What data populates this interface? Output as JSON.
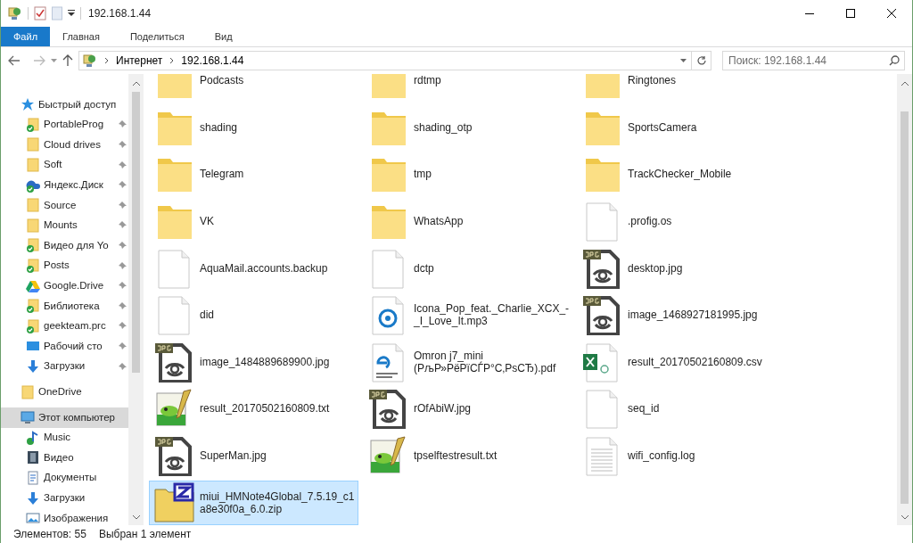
{
  "window": {
    "title": "192.168.1.44"
  },
  "ribbon_tabs": [
    {
      "label": "Файл",
      "kind": "file",
      "selected": false
    },
    {
      "label": "Главная",
      "kind": "tab",
      "selected": false
    },
    {
      "label": "Поделиться",
      "kind": "tab",
      "selected": false
    },
    {
      "label": "Вид",
      "kind": "tab",
      "selected": false
    }
  ],
  "address": {
    "crumbs": [
      "Интернет",
      "192.168.1.44"
    ]
  },
  "search": {
    "placeholder": "Поиск: 192.168.1.44"
  },
  "sidebar": {
    "items": [
      {
        "label": "Быстрый доступ",
        "kind": "star",
        "selected": false,
        "children": [
          {
            "label": "PortableProg",
            "kind": "synced",
            "pinned": true,
            "selected": false
          },
          {
            "label": "Cloud drives",
            "kind": "folder",
            "pinned": true,
            "selected": false
          },
          {
            "label": "Soft",
            "kind": "folder",
            "pinned": true,
            "selected": false
          },
          {
            "label": "Яндекс.Диск",
            "kind": "disk",
            "pinned": true,
            "selected": false
          },
          {
            "label": "Source",
            "kind": "folder",
            "pinned": true,
            "selected": false
          },
          {
            "label": "Mounts",
            "kind": "folder",
            "pinned": true,
            "selected": false
          },
          {
            "label": "Видео для Yo",
            "kind": "synced",
            "pinned": true,
            "selected": false
          },
          {
            "label": "Posts",
            "kind": "synced",
            "pinned": true,
            "selected": false
          },
          {
            "label": "Google.Drive",
            "kind": "gdrive",
            "pinned": true,
            "selected": false
          },
          {
            "label": "Библиотека",
            "kind": "synced",
            "pinned": true,
            "selected": false
          },
          {
            "label": "geekteam.prc",
            "kind": "synced",
            "pinned": true,
            "selected": false
          },
          {
            "label": "Рабочий сто",
            "kind": "desktop",
            "pinned": true,
            "selected": false
          },
          {
            "label": "Загрузки",
            "kind": "download",
            "pinned": true,
            "selected": false
          }
        ]
      },
      {
        "label": "OneDrive",
        "kind": "folder",
        "selected": false
      },
      {
        "label": "Этот компьютер",
        "kind": "pc",
        "selected": true,
        "children": [
          {
            "label": "Music",
            "kind": "music",
            "pinned": false,
            "selected": false
          },
          {
            "label": "Видео",
            "kind": "video",
            "pinned": false,
            "selected": false
          },
          {
            "label": "Документы",
            "kind": "docs",
            "pinned": false,
            "selected": false
          },
          {
            "label": "Загрузки",
            "kind": "download",
            "pinned": false,
            "selected": false
          },
          {
            "label": "Изображения",
            "kind": "images",
            "pinned": false,
            "selected": false
          }
        ]
      }
    ]
  },
  "files": [
    {
      "name": "Podcasts",
      "kind": "folder",
      "selected": false
    },
    {
      "name": "rdtmp",
      "kind": "folder",
      "selected": false
    },
    {
      "name": "Ringtones",
      "kind": "folder",
      "selected": false
    },
    {
      "name": "shading",
      "kind": "folder",
      "selected": false
    },
    {
      "name": "shading_otp",
      "kind": "folder",
      "selected": false
    },
    {
      "name": "SportsCamera",
      "kind": "folder",
      "selected": false
    },
    {
      "name": "Telegram",
      "kind": "folder",
      "selected": false
    },
    {
      "name": "tmp",
      "kind": "folder",
      "selected": false
    },
    {
      "name": "TrackChecker_Mobile",
      "kind": "folder",
      "selected": false
    },
    {
      "name": "VK",
      "kind": "folder",
      "selected": false
    },
    {
      "name": "WhatsApp",
      "kind": "folder",
      "selected": false
    },
    {
      "name": ".profig.os",
      "kind": "blank",
      "selected": false
    },
    {
      "name": "AquaMail.accounts.backup",
      "kind": "blank",
      "selected": false
    },
    {
      "name": "dctp",
      "kind": "blank",
      "selected": false
    },
    {
      "name": "desktop.jpg",
      "kind": "jpg",
      "selected": false
    },
    {
      "name": "did",
      "kind": "blank",
      "selected": false
    },
    {
      "name": "Icona_Pop_feat._Charlie_XCX_-_I_Love_It.mp3",
      "kind": "mp3",
      "selected": false
    },
    {
      "name": "image_1468927181995.jpg",
      "kind": "jpg",
      "selected": false
    },
    {
      "name": "image_1484889689900.jpg",
      "kind": "jpg",
      "selected": false
    },
    {
      "name": "Omron j7_mini (РљР»РёРїСЃР°С‚РѕСЂ).pdf",
      "kind": "pdf",
      "selected": false
    },
    {
      "name": "result_20170502160809.csv",
      "kind": "csv",
      "selected": false
    },
    {
      "name": "result_20170502160809.txt",
      "kind": "txt",
      "selected": false
    },
    {
      "name": "rOfAbiW.jpg",
      "kind": "jpg",
      "selected": false
    },
    {
      "name": "seq_id",
      "kind": "blank",
      "selected": false
    },
    {
      "name": "SuperMan.jpg",
      "kind": "jpg",
      "selected": false
    },
    {
      "name": "tpselftestresult.txt",
      "kind": "txt",
      "selected": false
    },
    {
      "name": "wifi_config.log",
      "kind": "log",
      "selected": false
    },
    {
      "name": "miui_HMNote4Global_7.5.19_c1a8e30f0a_6.0.zip",
      "kind": "zip",
      "selected": true
    }
  ],
  "status_bar": {
    "count": "Элементов: 55",
    "selection": "Выбран 1 элемент"
  }
}
